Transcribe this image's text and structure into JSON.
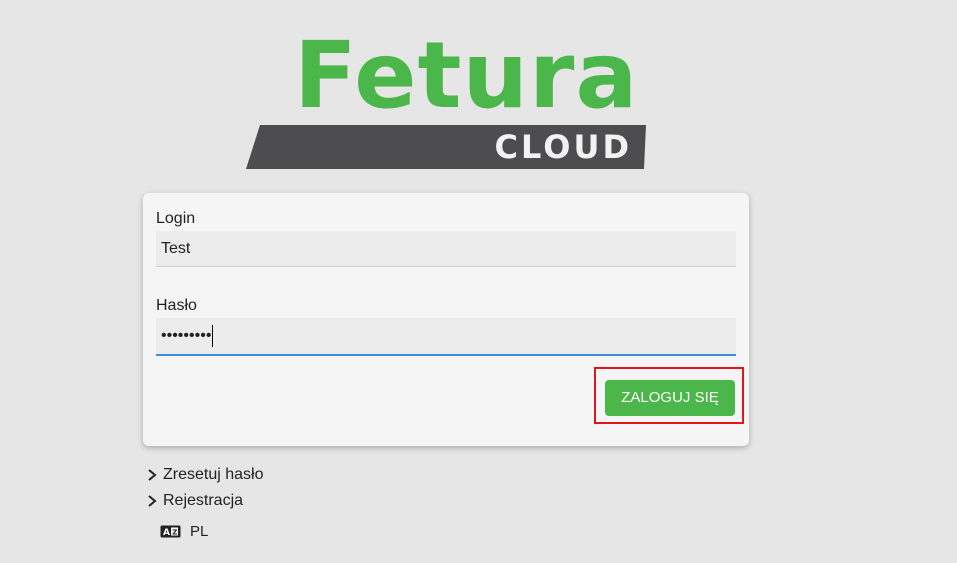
{
  "logo": {
    "word": "Fetura",
    "sub": "CLOUD",
    "colors": {
      "green": "#4bb649",
      "band": "#4d4d4f"
    }
  },
  "form": {
    "login_label": "Login",
    "login_value": "Test",
    "password_label": "Hasło",
    "password_value": "•••••••••",
    "submit_label": "ZALOGUJ SIĘ"
  },
  "links": {
    "reset": "Zresetuj hasło",
    "register": "Rejestracja"
  },
  "language": {
    "icon": "translate-icon",
    "label": "PL"
  },
  "colors": {
    "background": "#e6e6e6",
    "card": "#f5f5f5",
    "accent_green": "#4bb649",
    "focus_blue": "#3a8fd6",
    "highlight_red": "#e0161a"
  }
}
